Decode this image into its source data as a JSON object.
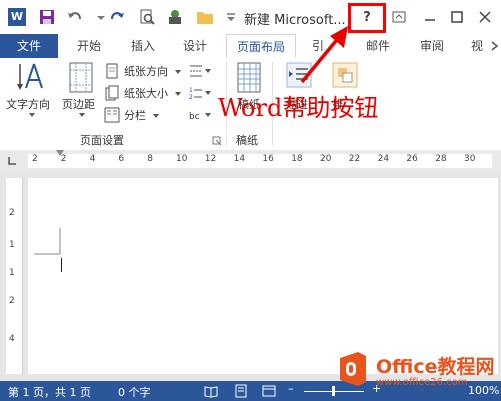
{
  "title_bar": {
    "app_icon": "W",
    "title": "新建 Microsoft...",
    "help_button": "?",
    "icons": [
      "word-app-icon",
      "save-icon",
      "undo-icon",
      "redo-icon",
      "print-preview-icon",
      "touch-mode-icon",
      "open-folder-icon",
      "customize-icon",
      "help-icon",
      "ribbon-display-icon",
      "minimize-icon",
      "maximize-icon",
      "close-icon"
    ]
  },
  "tabs": [
    {
      "label": "文件",
      "state": "file"
    },
    {
      "label": "开始",
      "state": ""
    },
    {
      "label": "插入",
      "state": ""
    },
    {
      "label": "设计",
      "state": ""
    },
    {
      "label": "页面布局",
      "state": "active"
    },
    {
      "label": "引",
      "state": ""
    },
    {
      "label": "邮件",
      "state": ""
    },
    {
      "label": "审阅",
      "state": ""
    },
    {
      "label": "视",
      "state": ""
    }
  ],
  "ribbon": {
    "text_direction": "文字方向",
    "margins": "页边距",
    "orientation": "纸张方向",
    "size": "纸张大小",
    "columns": "分栏",
    "page_setup_group": "页面设置",
    "manuscript_button": "稿纸",
    "manuscript_group": "稿纸",
    "indent_label": "缩进",
    "spacing_label": "排"
  },
  "rulers": {
    "h_ticks": [
      "2",
      "2",
      "4",
      "6",
      "8",
      "10",
      "12",
      "14",
      "16",
      "18",
      "20",
      "22",
      "24",
      "26",
      "28",
      "30"
    ],
    "v_ticks": [
      "2",
      "1",
      "1",
      "2",
      "4"
    ]
  },
  "status_bar": {
    "page": "第 1 页，共 1 页",
    "words": "0 个字",
    "zoom": "100%"
  },
  "annotation": {
    "text": "Word帮助按钮"
  },
  "watermark": {
    "brand": "Office教程网",
    "url": "www.office26.com"
  },
  "colors": {
    "word_blue": "#2b579a",
    "annotation_red": "#e60000",
    "watermark_orange": "#e8541b"
  }
}
